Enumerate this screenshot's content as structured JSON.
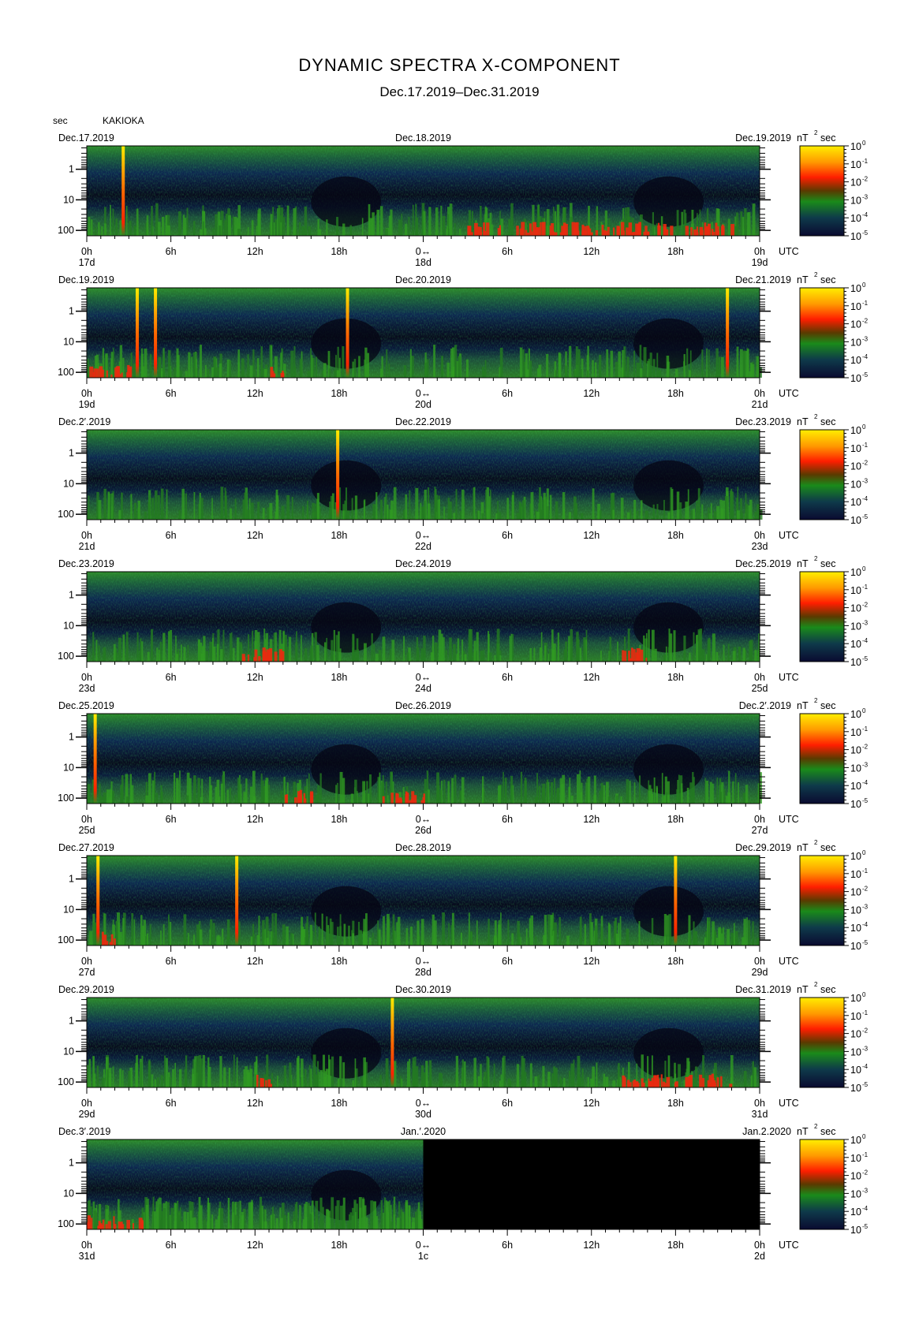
{
  "title": "DYNAMIC SPECTRA X-COMPONENT",
  "subtitle": "Dec.17.2019–Dec.31.2019",
  "unit_label": "sec",
  "station": "KAKIOKA",
  "colorbar_unit": "nT",
  "colorbar_unit_exp": "2",
  "colorbar_unit_tail": "sec",
  "colorbar_ticks": [
    "10",
    "10",
    "10",
    "10",
    "10",
    "10"
  ],
  "colorbar_exponents": [
    "0",
    "-1",
    "-2",
    "-3",
    "-4",
    "-5"
  ],
  "colors": {
    "background": "#ffffff",
    "spectrum_high": "#ffee00",
    "spectrum_mid": "#ff2a00",
    "spectrum_low": "#1f8a1f",
    "spectrum_floor": "#101040",
    "no_data": "#000000"
  },
  "chart_data": {
    "type": "heatmap",
    "ylabel": "sec",
    "y_ticks": [
      "1",
      "10",
      "100"
    ],
    "x_ticks": [
      "0h",
      "6h",
      "12h",
      "18h",
      "0h",
      "6h",
      "12h",
      "18h",
      "0h"
    ],
    "x_unit": "UTC",
    "panels": [
      {
        "date_left": "Dec.17.2019",
        "date_mid": "Dec.18.2019",
        "date_right": "Dec.19.2019",
        "day_left": "17d",
        "day_mid": "18d",
        "day_right": "19d",
        "mid_tick": "0↔",
        "spikes_h": [
          2.6
        ],
        "red_ranges_h": [
          [
            27,
            46
          ]
        ],
        "no_data_from_h": null
      },
      {
        "date_left": "Dec.19.2019",
        "date_mid": "Dec.20.2019",
        "date_right": "Dec.21.2019",
        "day_left": "19d",
        "day_mid": "20d",
        "day_right": "21d",
        "mid_tick": "0↔",
        "spikes_h": [
          3.6,
          4.9,
          18.6,
          45.7
        ],
        "red_ranges_h": [
          [
            0,
            3
          ],
          [
            13,
            14
          ]
        ],
        "no_data_from_h": null
      },
      {
        "date_left": "Dec.2′.2019",
        "date_mid": "Dec.22.2019",
        "date_right": "Dec.23.2019",
        "day_left": "21d",
        "day_mid": "22d",
        "day_right": "23d",
        "mid_tick": "0↔",
        "spikes_h": [
          17.9
        ],
        "red_ranges_h": [],
        "no_data_from_h": null
      },
      {
        "date_left": "Dec.23.2019",
        "date_mid": "Dec.24.2019",
        "date_right": "Dec.25.2019",
        "day_left": "23d",
        "day_mid": "24d",
        "day_right": "25d",
        "mid_tick": "0↔",
        "spikes_h": [],
        "red_ranges_h": [
          [
            11,
            14
          ],
          [
            38,
            40
          ]
        ],
        "no_data_from_h": null
      },
      {
        "date_left": "Dec.25.2019",
        "date_mid": "Dec.26.2019",
        "date_right": "Dec.2′.2019",
        "day_left": "25d",
        "day_mid": "26d",
        "day_right": "27d",
        "mid_tick": "0↔",
        "spikes_h": [
          0.6
        ],
        "red_ranges_h": [
          [
            14,
            16
          ],
          [
            21,
            24
          ]
        ],
        "no_data_from_h": null
      },
      {
        "date_left": "Dec.27.2019",
        "date_mid": "Dec.28.2019",
        "date_right": "Dec.29.2019",
        "day_left": "27d",
        "day_mid": "28d",
        "day_right": "29d",
        "mid_tick": "0↔",
        "spikes_h": [
          0.8,
          10.7,
          42.0
        ],
        "red_ranges_h": [
          [
            1,
            2
          ]
        ],
        "no_data_from_h": null
      },
      {
        "date_left": "Dec.29.2019",
        "date_mid": "Dec.30.2019",
        "date_right": "Dec.31.2019",
        "day_left": "29d",
        "day_mid": "30d",
        "day_right": "31d",
        "mid_tick": "0↔",
        "spikes_h": [
          21.8
        ],
        "red_ranges_h": [
          [
            12,
            13
          ],
          [
            38,
            46
          ]
        ],
        "no_data_from_h": null
      },
      {
        "date_left": "Dec.3′.2019",
        "date_mid": "Jan.′.2020",
        "date_right": "Jan.2.2020",
        "day_left": "31d",
        "day_mid": "1c",
        "day_right": "2d",
        "mid_tick": "0↔",
        "spikes_h": [],
        "red_ranges_h": [
          [
            0,
            4
          ]
        ],
        "no_data_from_h": 24
      }
    ]
  }
}
